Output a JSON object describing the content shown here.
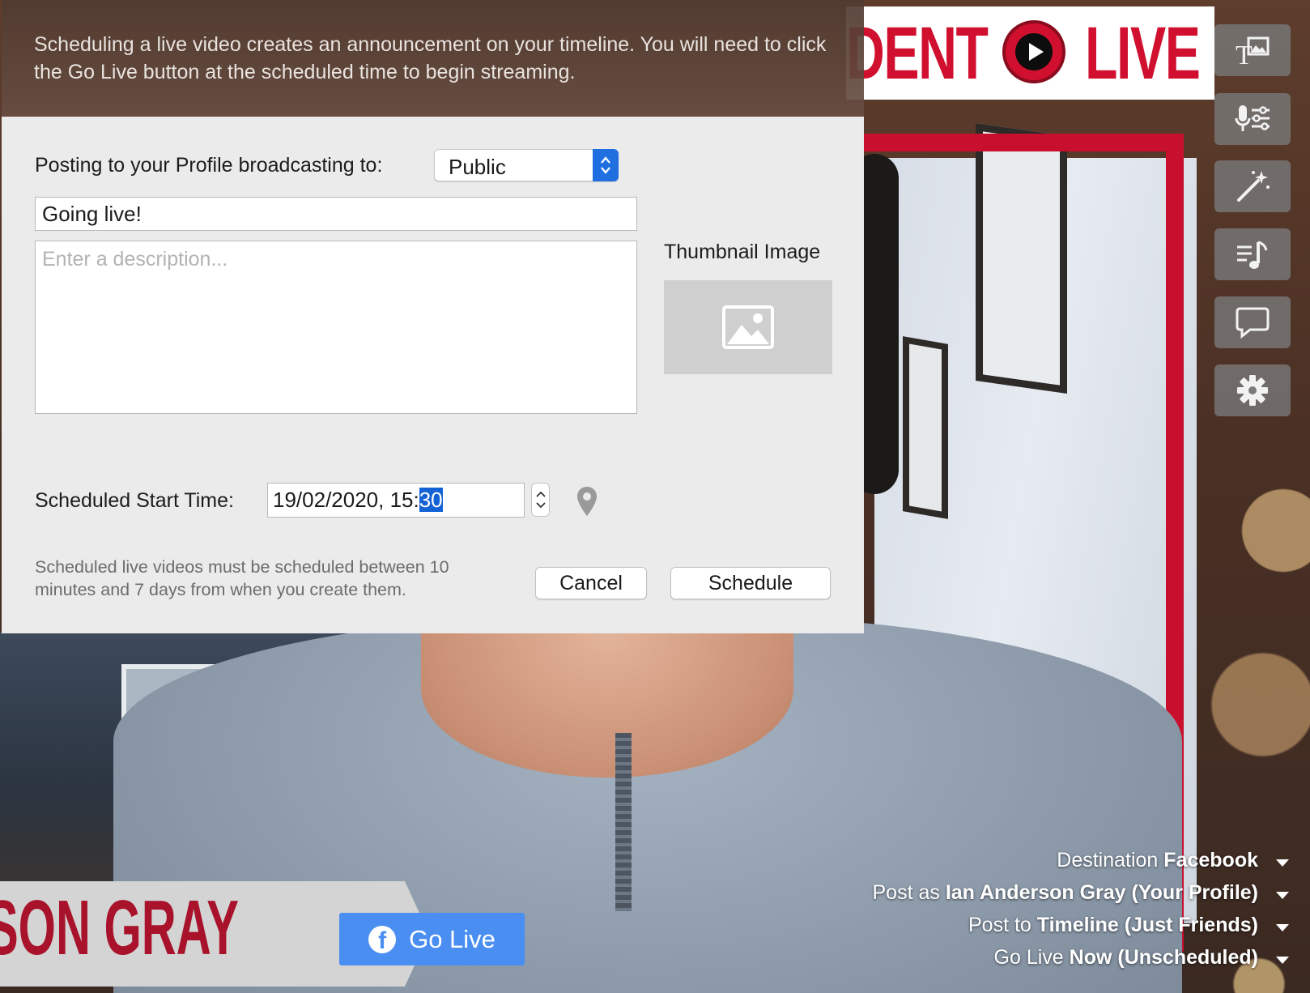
{
  "banner": {
    "text": "Scheduling a live video creates an announcement on your timeline. You will need to click the Go Live button at the scheduled time to begin streaming."
  },
  "dialog": {
    "posting_label": "Posting to your Profile broadcasting to:",
    "audience_value": "Public",
    "title_value": "Going live!",
    "description_placeholder": "Enter a description...",
    "thumbnail_label": "Thumbnail Image",
    "start_time_label": "Scheduled Start Time:",
    "start_time_prefix": "19/02/2020, 15:",
    "start_time_selected": "30",
    "note": "Scheduled live videos must be scheduled between 10 minutes and 7 days from when you create them.",
    "cancel_label": "Cancel",
    "schedule_label": "Schedule"
  },
  "overlay": {
    "logo_left": "DENT",
    "logo_right": "LIVE",
    "nameplate": "RSON GRAY",
    "go_live_label": "Go Live"
  },
  "toolbar": {
    "icons": [
      "text-image-icon",
      "microphone-settings-icon",
      "magic-wand-icon",
      "music-playlist-icon",
      "comment-icon",
      "gear-icon"
    ]
  },
  "settings": {
    "destination_label": "Destination",
    "destination_value": "Facebook",
    "post_as_label": "Post as",
    "post_as_value": "Ian Anderson Gray (Your Profile)",
    "post_to_label": "Post to",
    "post_to_value": "Timeline (Just Friends)",
    "go_live_label": "Go Live",
    "go_live_value": "Now (Unscheduled)"
  },
  "colors": {
    "accent_blue": "#1f6fe0",
    "go_live_blue": "#4a8ef2",
    "brand_red": "#c8102e"
  }
}
